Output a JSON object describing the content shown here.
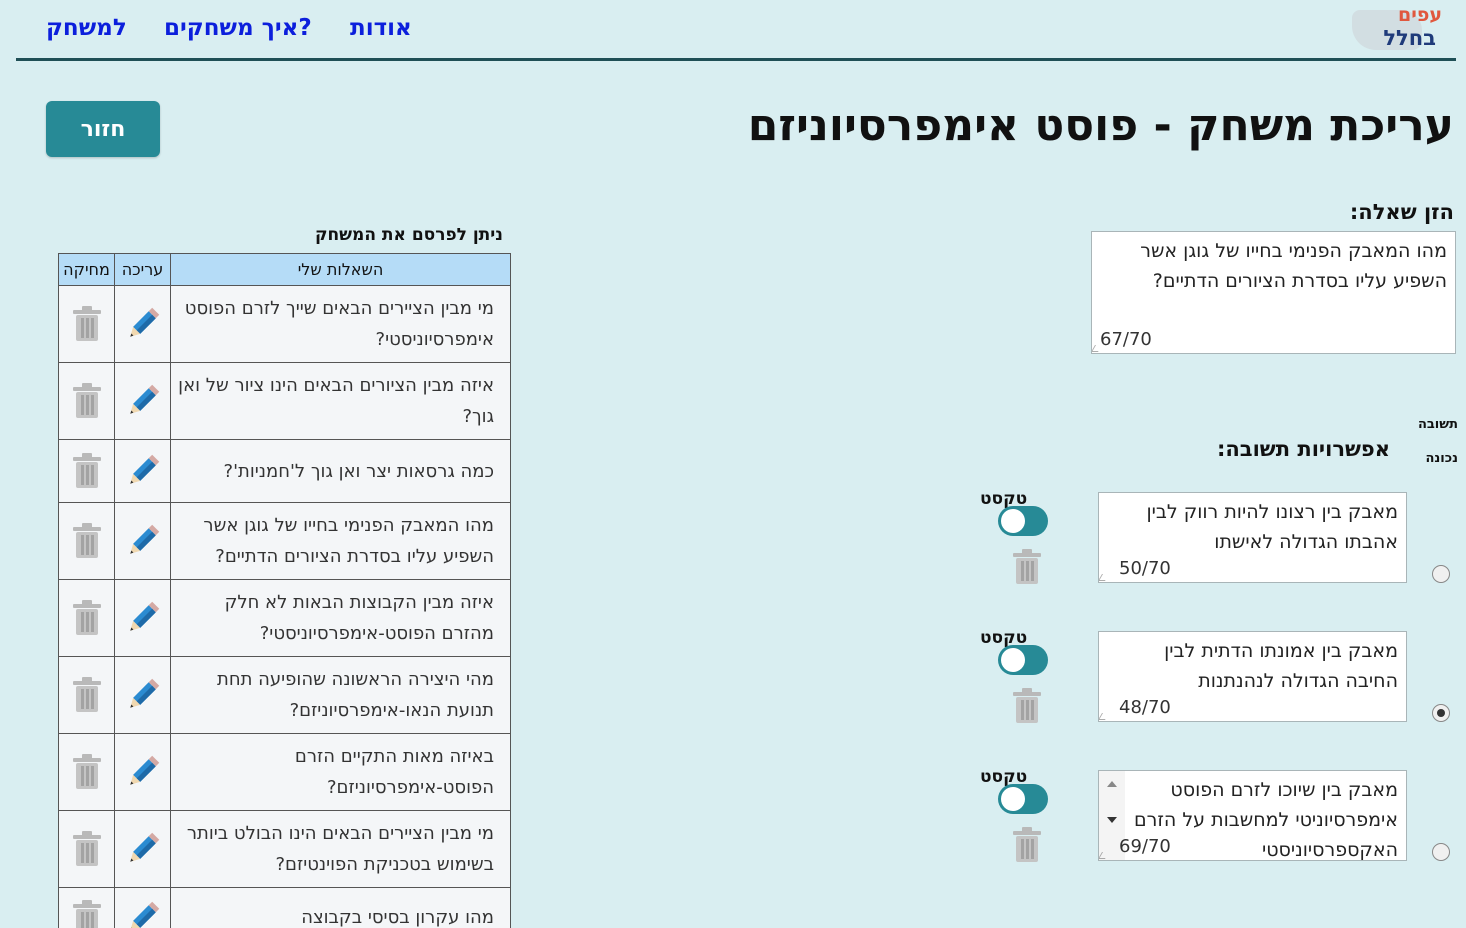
{
  "nav": {
    "play": "למשחק",
    "how_to": "איך משחקים?",
    "about": "אודות"
  },
  "logo": {
    "line1": "עפים",
    "line2": "בחלל"
  },
  "page_title": "עריכת משחק - פוסט אימפרסיוניזם",
  "back_button": "חזור",
  "question": {
    "label": "הזן שאלה:",
    "value": "מהו המאבק הפנימי בחייו של גוגן אשר השפיע עליו בסדרת הציורים הדתיים?",
    "counter": "67/70"
  },
  "correct_answer_label": "תשובה נכונה",
  "answer_options_label": "אפשרויות תשובה:",
  "answers": [
    {
      "text": "מאבק בין רצונו להיות רווק לבין אהבתו הגדולה לאישתו",
      "counter": "50/70",
      "toggle_label": "טקסט",
      "selected": false
    },
    {
      "text": "מאבק בין אמונתו הדתית לבין החיבה הגדולה לנהנתנות",
      "counter": "48/70",
      "toggle_label": "טקסט",
      "selected": true
    },
    {
      "text": "מאבק בין שיוכו לזרם הפוסט אימפרסיוניטי למחשבות על הזרם האקספרסיוניסטי",
      "counter": "69/70",
      "toggle_label": "טקסט",
      "selected": false
    }
  ],
  "table": {
    "publish_note": "ניתן לפרסם את המשחק",
    "headers": {
      "questions": "השאלות שלי",
      "edit": "עריכה",
      "delete": "מחיקה"
    },
    "rows": [
      "מי מבין הציירים הבאים שייך לזרם הפוסט אימפרסיוניסטי?",
      "איזה מבין הציורים הבאים הינו ציור של ואן גוך?",
      "כמה גרסאות יצר ואן גוך ל'חמניות'?",
      "מהו המאבק הפנימי בחייו של גוגן אשר השפיע עליו בסדרת הציורים הדתיים?",
      "איזה מבין הקבוצות הבאות לא חלק מהזרם הפוסט-אימפרסיוניסטי?",
      "מהי היצירה הראשונה שהופיעה תחת תנועת הנאו-אימפרסיוניזם?",
      "באיזה מאות התקיים הזרם הפוסט-אימפרסיוניזם?",
      "מי מבין הציירים הבאים הינו הבולט ביותר בשימוש בטכניקת הפוינטיזם?",
      "מהו עקרון בסיסי בקבוצה"
    ]
  },
  "colors": {
    "background": "#d9eef1",
    "accent": "#278a96",
    "nav_link": "#0c1fdc",
    "table_header": "#b5dcf7"
  }
}
